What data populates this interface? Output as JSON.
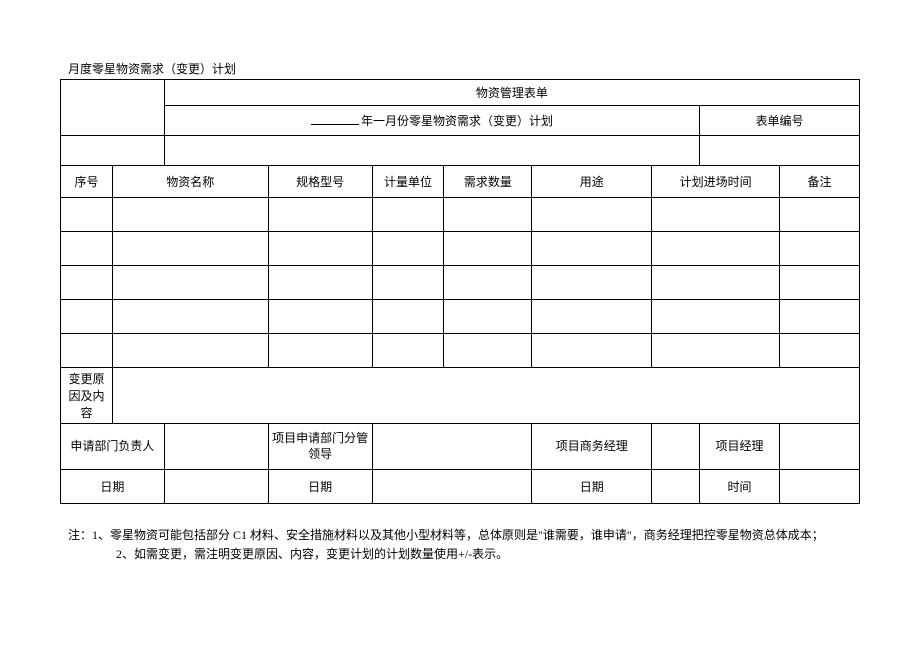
{
  "title": "月度零星物资需求（变更）计划",
  "headerBand": "物资管理表单",
  "subtitle": "年一月份零星物资需求（变更）计划",
  "formNoLabel": "表单编号",
  "formNoValue": "",
  "columns": {
    "seq": "序号",
    "name": "物资名称",
    "spec": "规格型号",
    "unit": "计量单位",
    "qty": "需求数量",
    "usage": "用途",
    "planEntry": "计划进场时间",
    "remark": "备注"
  },
  "rows": [
    {
      "seq": "",
      "name": "",
      "spec": "",
      "unit": "",
      "qty": "",
      "usage": "",
      "planEntry": "",
      "remark": ""
    },
    {
      "seq": "",
      "name": "",
      "spec": "",
      "unit": "",
      "qty": "",
      "usage": "",
      "planEntry": "",
      "remark": ""
    },
    {
      "seq": "",
      "name": "",
      "spec": "",
      "unit": "",
      "qty": "",
      "usage": "",
      "planEntry": "",
      "remark": ""
    },
    {
      "seq": "",
      "name": "",
      "spec": "",
      "unit": "",
      "qty": "",
      "usage": "",
      "planEntry": "",
      "remark": ""
    },
    {
      "seq": "",
      "name": "",
      "spec": "",
      "unit": "",
      "qty": "",
      "usage": "",
      "planEntry": "",
      "remark": ""
    }
  ],
  "changeReasonLabel": "变更原因及内容",
  "changeReasonValue": "",
  "signatures": {
    "col1Label": "申请部门负责人",
    "col1Value": "",
    "col2Label": "项目申请部门分管领导",
    "col2Value": "",
    "col3Label": "项目商务经理",
    "col3Value": "",
    "col4Label": "项目经理",
    "col4Value": ""
  },
  "dates": {
    "d1Label": "日期",
    "d1Value": "",
    "d2Label": "日期",
    "d2Value": "",
    "d3Label": "日期",
    "d3Value": "",
    "d4Label": "时间",
    "d4Value": ""
  },
  "notes": {
    "line1": "注：1、零星物资可能包括部分 C1 材料、安全措施材料以及其他小型材料等，总体原则是\"谁需要，谁申请\"，商务经理把控零星物资总体成本；",
    "line2": "2、如需变更，需注明变更原因、内容，变更计划的计划数量使用+/-表示。"
  }
}
